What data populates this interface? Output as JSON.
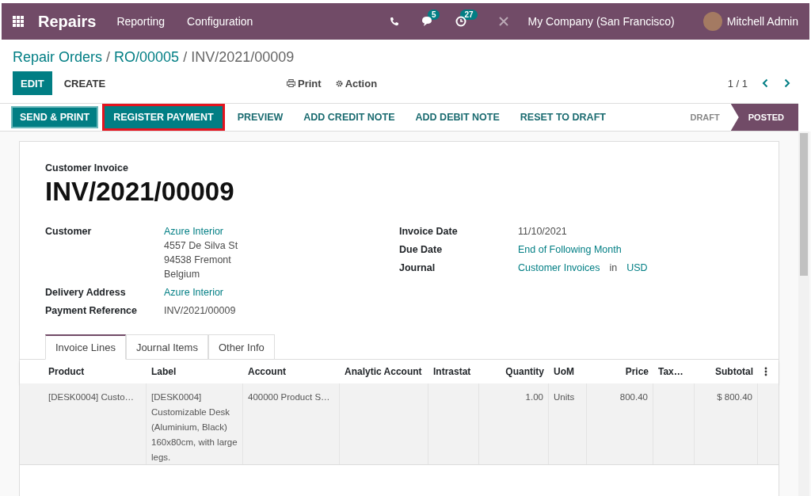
{
  "navbar": {
    "app": "Repairs",
    "menu": [
      "Reporting",
      "Configuration"
    ],
    "messages_badge": "5",
    "activities_badge": "27",
    "company": "My Company (San Francisco)",
    "user": "Mitchell Admin"
  },
  "breadcrumb_separator": "/",
  "breadcrumb": [
    {
      "label": "Repair Orders",
      "link": true
    },
    {
      "label": "RO/00005",
      "link": true
    },
    {
      "label": "INV/2021/00009",
      "link": false
    }
  ],
  "control": {
    "buttons": [
      {
        "label": "EDIT",
        "kind": "primary"
      },
      {
        "label": "CREATE",
        "kind": "plain"
      }
    ],
    "print": "Print",
    "action": "Action",
    "pager": "1 / 1"
  },
  "statusbar": {
    "buttons": [
      {
        "label": "SEND & PRINT",
        "kind": "primary",
        "highlighted": false
      },
      {
        "label": "REGISTER PAYMENT",
        "kind": "primary",
        "highlighted": true
      },
      {
        "label": "PREVIEW",
        "kind": "plain",
        "highlighted": false
      },
      {
        "label": "ADD CREDIT NOTE",
        "kind": "plain",
        "highlighted": false
      },
      {
        "label": "ADD DEBIT NOTE",
        "kind": "plain",
        "highlighted": false
      },
      {
        "label": "RESET TO DRAFT",
        "kind": "plain",
        "highlighted": false
      }
    ],
    "stages": [
      {
        "label": "DRAFT",
        "selected": false
      },
      {
        "label": "POSTED",
        "selected": true
      }
    ]
  },
  "sheet": {
    "subtitle": "Customer Invoice",
    "title": "INV/2021/00009",
    "left_fields": [
      {
        "label": "Customer",
        "lines": [
          {
            "text": "Azure Interior",
            "link": true
          },
          {
            "text": "4557 De Silva St",
            "link": false
          },
          {
            "text": "94538 Fremont",
            "link": false
          },
          {
            "text": "Belgium",
            "link": false
          }
        ]
      },
      {
        "label": "Delivery Address",
        "lines": [
          {
            "text": "Azure Interior",
            "link": true
          }
        ]
      },
      {
        "label": "Payment Reference",
        "lines": [
          {
            "text": "INV/2021/00009",
            "link": false
          }
        ]
      }
    ],
    "right_fields": [
      {
        "label": "Invoice Date",
        "lines": [
          {
            "text": "11/10/2021",
            "link": false
          }
        ]
      },
      {
        "label": "Due Date",
        "lines": [
          {
            "text": "End of Following Month",
            "link": true
          }
        ]
      },
      {
        "label": "Journal",
        "lines": [
          {
            "text": "Customer Invoices",
            "link": true
          },
          {
            "text": "in",
            "link": false
          },
          {
            "text": "USD",
            "link": true
          }
        ]
      }
    ],
    "tabs": [
      {
        "label": "Invoice Lines",
        "selected": true
      },
      {
        "label": "Journal Items",
        "selected": false
      },
      {
        "label": "Other Info",
        "selected": false
      }
    ],
    "table": {
      "columns": [
        {
          "label": "Product",
          "numeric": false
        },
        {
          "label": "Label",
          "numeric": false
        },
        {
          "label": "Account",
          "numeric": false
        },
        {
          "label": "Analytic Account",
          "numeric": false
        },
        {
          "label": "Intrastat",
          "numeric": false
        },
        {
          "label": "Quantity",
          "numeric": true
        },
        {
          "label": "UoM",
          "numeric": false
        },
        {
          "label": "Price",
          "numeric": true
        },
        {
          "label": "Tax…",
          "numeric": false
        },
        {
          "label": "Subtotal",
          "numeric": true
        }
      ],
      "rows": [
        [
          "[DESK0004] Custo…",
          "[DESK0004] Customizable Desk (Aluminium, Black) 160x80cm, with large legs.",
          "400000 Product S…",
          "",
          "",
          "1.00",
          "Units",
          "800.40",
          "",
          "$ 800.40"
        ]
      ]
    }
  }
}
